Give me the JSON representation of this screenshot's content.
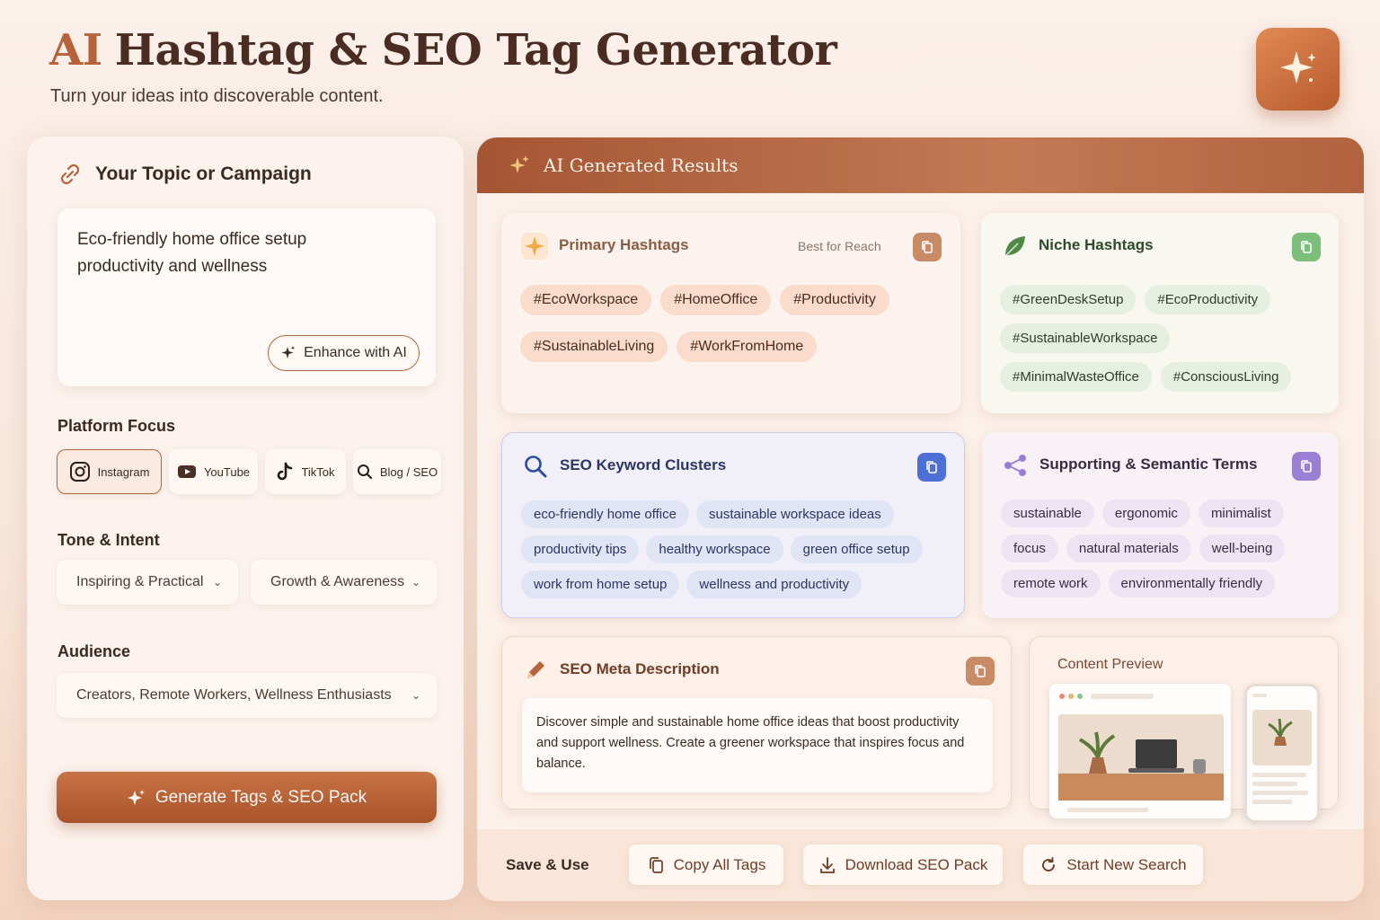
{
  "header": {
    "title_ai": "AI",
    "title_rest": "Hashtag & SEO Tag Generator",
    "subtitle": "Turn your ideas into discoverable content."
  },
  "left": {
    "topic_label": "Your Topic or Campaign",
    "topic_text": "Eco-friendly home office setup productivity and wellness",
    "enhance_label": "Enhance with AI",
    "platform_label": "Platform Focus",
    "platforms": [
      {
        "label": "Instagram",
        "icon": "instagram-icon"
      },
      {
        "label": "YouTube",
        "icon": "youtube-icon"
      },
      {
        "label": "TikTok",
        "icon": "tiktok-icon"
      },
      {
        "label": "Blog / SEO",
        "icon": "search-icon"
      }
    ],
    "tone_label": "Tone & Intent",
    "tone_value": "Inspiring & Practical",
    "intent_value": "Growth & Awareness",
    "audience_label": "Audience",
    "audience_value": "Creators, Remote Workers, Wellness Enthusiasts",
    "generate_label": "Generate Tags & SEO Pack"
  },
  "results": {
    "header_title": "AI Generated Results",
    "primary": {
      "title": "Primary Hashtags",
      "note": "Best for Reach",
      "tags": [
        "#EcoWorkspace",
        "#HomeOffice",
        "#Productivity",
        "#SustainableLiving",
        "#WorkFromHome"
      ]
    },
    "niche": {
      "title": "Niche Hashtags",
      "tags": [
        "#GreenDeskSetup",
        "#EcoProductivity",
        "#SustainableWorkspace",
        "#MinimalWasteOffice",
        "#ConsciousLiving"
      ]
    },
    "seo": {
      "title": "SEO Keyword Clusters",
      "tags": [
        "eco-friendly home office",
        "sustainable workspace ideas",
        "productivity tips",
        "healthy workspace",
        "green office setup",
        "work from home setup",
        "wellness and productivity"
      ]
    },
    "support": {
      "title": "Supporting & Semantic Terms",
      "tags": [
        "sustainable",
        "ergonomic",
        "minimalist",
        "focus",
        "natural materials",
        "well-being",
        "remote work",
        "environmentally friendly"
      ]
    },
    "meta": {
      "title": "SEO Meta Description",
      "text": "Discover simple and sustainable home office ideas that boost productivity and support wellness. Create a greener workspace that inspires focus and balance."
    },
    "preview": {
      "title": "Content Preview"
    }
  },
  "footer": {
    "save_label": "Save & Use",
    "copy_all": "Copy All Tags",
    "download": "Download SEO Pack",
    "new_search": "Start New Search"
  },
  "colors": {
    "accent": "#b8623c",
    "primary_chip": "#f9dccb",
    "niche_chip": "#e7efe0",
    "seo_chip": "#e1e4f5",
    "support_chip": "#ece4f3",
    "copy_primary": "#c98a66",
    "copy_niche": "#7cbf7a",
    "copy_seo": "#4f6fd8",
    "copy_support": "#9b7fd6",
    "copy_meta": "#c98a66"
  }
}
